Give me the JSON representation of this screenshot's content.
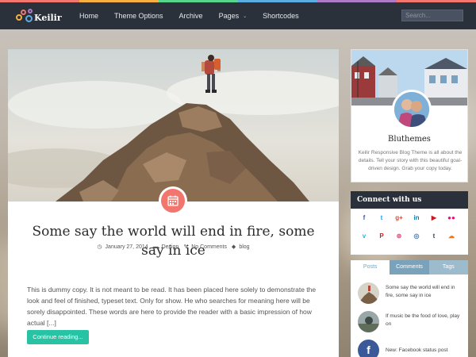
{
  "brand": {
    "name": "Keilir"
  },
  "nav": {
    "items": [
      {
        "label": "Home"
      },
      {
        "label": "Theme Options"
      },
      {
        "label": "Archive"
      },
      {
        "label": "Pages",
        "has_caret": true
      },
      {
        "label": "Shortcodes"
      }
    ],
    "caret_glyph": "⌄",
    "search_placeholder": "Search..."
  },
  "post": {
    "title": "Some say the world will end in fire, some say in ice",
    "date": "January 27, 2014",
    "category": "Design",
    "comments": "No Comments",
    "tag": "blog",
    "excerpt": "This is dummy copy. It is not meant to be read. It has been placed here solely to demonstrate the look and feel of finished, typeset text. Only for show. He who searches for meaning here will be sorely disappointed. These words are here to provide the reader with a basic impression of how actual [...]",
    "button_label": "Continue reading..."
  },
  "profile": {
    "name": "Bluthemes",
    "description": "Keilir Responsive Blog Theme is all about the details. Tell your story with this beautiful goal-driven design. Grab your copy today."
  },
  "connect": {
    "title": "Connect with us",
    "icons": [
      {
        "name": "facebook-icon",
        "glyph": "f",
        "color": "#3b5998"
      },
      {
        "name": "twitter-icon",
        "glyph": "t",
        "color": "#1da1f2"
      },
      {
        "name": "google-plus-icon",
        "glyph": "g+",
        "color": "#dd4b39"
      },
      {
        "name": "linkedin-icon",
        "glyph": "in",
        "color": "#0e76a8"
      },
      {
        "name": "youtube-icon",
        "glyph": "▶",
        "color": "#cc181e"
      },
      {
        "name": "flickr-icon",
        "glyph": "●●",
        "color": "#ff0084"
      },
      {
        "name": "vimeo-icon",
        "glyph": "v",
        "color": "#1ab7ea"
      },
      {
        "name": "pinterest-icon",
        "glyph": "P",
        "color": "#cb2027"
      },
      {
        "name": "dribbble-icon",
        "glyph": "⊛",
        "color": "#ea4c89"
      },
      {
        "name": "instagram-icon",
        "glyph": "◎",
        "color": "#4b7bb0"
      },
      {
        "name": "tumblr-icon",
        "glyph": "t",
        "color": "#35465c"
      },
      {
        "name": "soundcloud-icon",
        "glyph": "☁",
        "color": "#ff7700"
      }
    ]
  },
  "tabs": {
    "labels": [
      "Posts",
      "Comments",
      "Tags"
    ],
    "items": [
      {
        "title": "Some say the world will end in fire, some say in ice"
      },
      {
        "title": "If music be the food of love, play on"
      },
      {
        "title": "New: Facebook status post"
      }
    ]
  },
  "colors": {
    "accent_green": "#27c3a4",
    "calendar_coral": "#f2766e",
    "header_dark": "#2b313b"
  }
}
